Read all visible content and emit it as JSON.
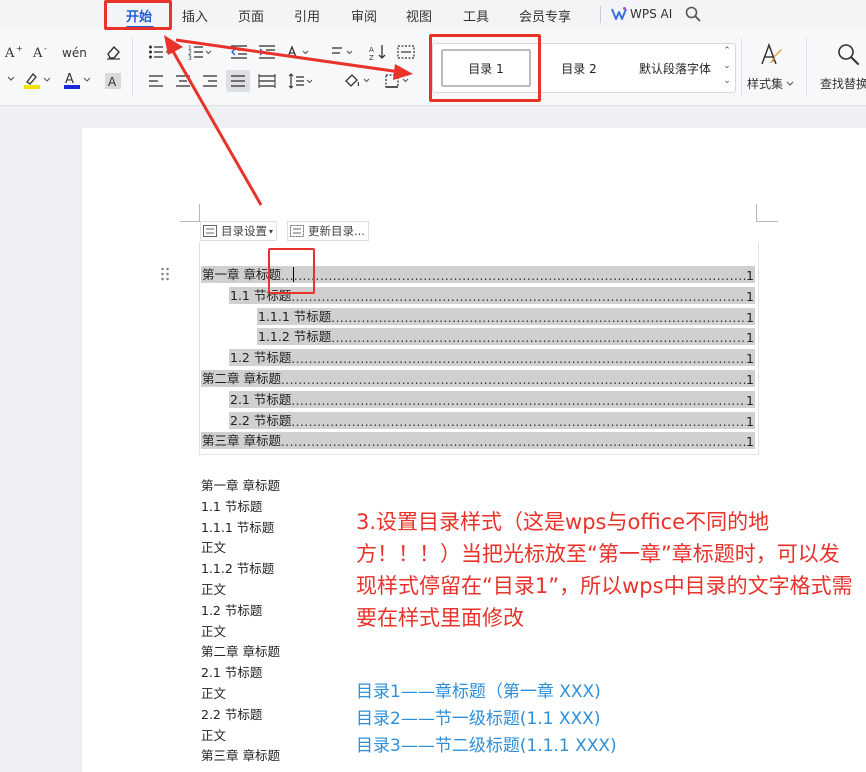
{
  "menu": {
    "items": [
      "开始",
      "插入",
      "页面",
      "引用",
      "审阅",
      "视图",
      "工具",
      "会员专享"
    ],
    "active": "开始",
    "wps_ai": "WPS AI"
  },
  "ribbon": {
    "styles": [
      "目录 1",
      "目录 2",
      "默认段落字体"
    ],
    "style_set": "样式集",
    "find_replace": "查找替换"
  },
  "toc_toolbar": {
    "settings": "目录设置",
    "update": "更新目录..."
  },
  "toc": [
    {
      "text": "第一章  章标题",
      "page": "1",
      "level": 1
    },
    {
      "text": "1.1  节标题",
      "page": "1",
      "level": 2
    },
    {
      "text": "1.1.1  节标题",
      "page": "1",
      "level": 3
    },
    {
      "text": "1.1.2  节标题",
      "page": "1",
      "level": 3
    },
    {
      "text": "1.2  节标题",
      "page": "1",
      "level": 2
    },
    {
      "text": "第二章  章标题",
      "page": "1",
      "level": 1
    },
    {
      "text": "2.1  节标题",
      "page": "1",
      "level": 2
    },
    {
      "text": "2.2  节标题",
      "page": "1",
      "level": 2
    },
    {
      "text": "第三章  章标题",
      "page": "1",
      "level": 1
    }
  ],
  "body": [
    "第一章  章标题",
    "1.1  节标题",
    "1.1.1  节标题",
    "正文",
    "1.1.2  节标题",
    "正文",
    "1.2  节标题",
    "正文",
    "第二章  章标题",
    "2.1  节标题",
    "正文",
    "2.2  节标题",
    "正文",
    "第三章  章标题"
  ],
  "annotation": {
    "red": "3.设置目录样式（这是wps与office不同的地方！！！）当把光标放至“第一章”章标题时，可以发现样式停留在“目录1”，所以wps中目录的文字格式需要在样式里面修改",
    "blue": [
      "目录1——章标题（第一章 XXX)",
      "目录2——节一级标题(1.1 XXX)",
      "目录3——节二级标题(1.1.1 XXX)"
    ]
  },
  "colors": {
    "annotation_red": "#e8322a",
    "annotation_blue": "#2f8fd8",
    "tab_active": "#1f5fd6",
    "toc_highlight": "#d0d0d0"
  }
}
